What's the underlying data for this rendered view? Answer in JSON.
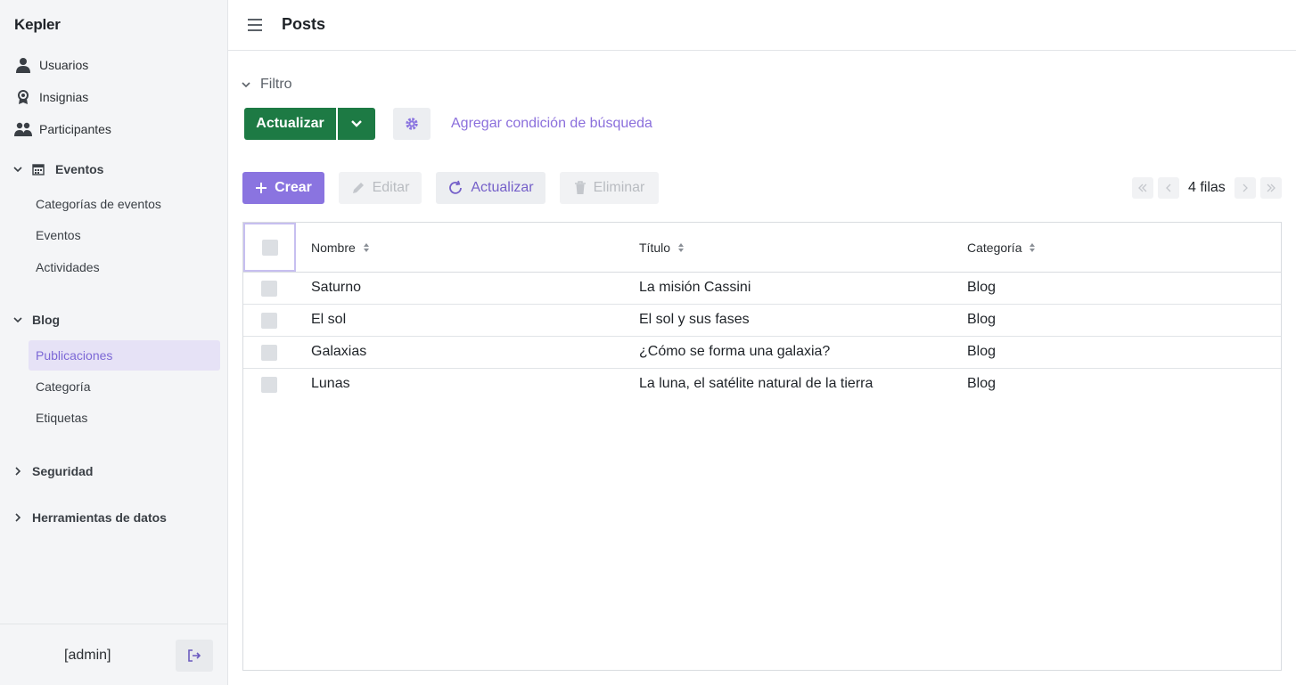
{
  "app": {
    "name": "Kepler"
  },
  "sidebar": {
    "top_items": [
      {
        "label": "Usuarios",
        "icon": "user-icon"
      },
      {
        "label": "Insignias",
        "icon": "badge-icon"
      },
      {
        "label": "Participantes",
        "icon": "users-icon"
      }
    ],
    "groups": [
      {
        "label": "Eventos",
        "expanded": true,
        "icon": "calendar-icon",
        "items": [
          "Categorías de eventos",
          "Eventos",
          "Actividades"
        ]
      },
      {
        "label": "Blog",
        "expanded": true,
        "items": [
          "Publicaciones",
          "Categoría",
          "Etiquetas"
        ],
        "active": "Publicaciones"
      },
      {
        "label": "Seguridad",
        "expanded": false
      },
      {
        "label": "Herramientas de datos",
        "expanded": false
      }
    ],
    "footer": {
      "user": "[admin]",
      "logout_icon": "logout-icon"
    }
  },
  "header": {
    "title": "Posts",
    "menu_icon": "hamburger-icon"
  },
  "filter": {
    "label": "Filtro",
    "apply_label": "Actualizar",
    "add_condition": "Agregar condición de búsqueda"
  },
  "toolbar": {
    "create": "Crear",
    "edit": "Editar",
    "refresh": "Actualizar",
    "delete": "Eliminar"
  },
  "pagination": {
    "rows_label": "4 filas"
  },
  "table": {
    "columns": [
      "Nombre",
      "Título",
      "Categoría"
    ],
    "rows": [
      {
        "nombre": "Saturno",
        "titulo": "La misión Cassini",
        "categoria": "Blog"
      },
      {
        "nombre": "El sol",
        "titulo": "El sol y sus fases",
        "categoria": "Blog"
      },
      {
        "nombre": "Galaxias",
        "titulo": "¿Cómo se forma una galaxia?",
        "categoria": "Blog"
      },
      {
        "nombre": "Lunas",
        "titulo": "La luna, el satélite natural de la tierra",
        "categoria": "Blog"
      }
    ]
  },
  "colors": {
    "accent": "#8a74e0",
    "primary_green": "#1d7a44",
    "link": "#8b6fdc",
    "active_bg": "#e6e2f6"
  }
}
